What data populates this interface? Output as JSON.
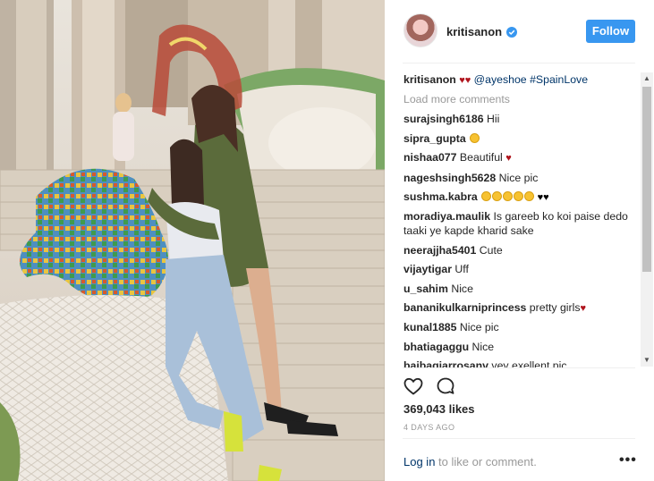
{
  "header": {
    "username": "kritisanon",
    "follow_label": "Follow"
  },
  "caption": {
    "username": "kritisanon",
    "mention": "@ayeshoe",
    "hashtag": "#SpainLove"
  },
  "load_more_label": "Load more comments",
  "comments": [
    {
      "user": "surajsingh6186",
      "text": "Hii"
    },
    {
      "user": "sipra_gupta",
      "text": ""
    },
    {
      "user": "nishaa077",
      "text": "Beautiful"
    },
    {
      "user": "nageshsingh5628",
      "text": "Nice pic"
    },
    {
      "user": "sushma.kabra",
      "text": ""
    },
    {
      "user": "moradiya.maulik",
      "text": "Is gareeb ko koi paise dedo taaki ye kapde kharid sake"
    },
    {
      "user": "neerajjha5401",
      "text": "Cute"
    },
    {
      "user": "vijaytigar",
      "text": "Uff"
    },
    {
      "user": "u_sahim",
      "text": "Nice"
    },
    {
      "user": "bananikulkarniprincess",
      "text": "pretty girls"
    },
    {
      "user": "kunal1885",
      "text": "Nice pic"
    },
    {
      "user": "bhatiagaggu",
      "text": "Nice"
    },
    {
      "user": "baibagiarrosanv",
      "text": "vey exellent pic"
    }
  ],
  "likes": "369,043 likes",
  "time_ago": "4 DAYS AGO",
  "footer": {
    "login_link": "Log in",
    "login_rest": " to like or comment.",
    "more_label": "•••"
  },
  "icons": {
    "verified": "verified-badge-icon",
    "like": "heart-outline-icon",
    "comment": "comment-bubble-icon",
    "more": "more-options-icon"
  },
  "colors": {
    "follow_button": "#3897f0",
    "link": "#003569",
    "muted": "#999999",
    "heart": "#b0141d"
  }
}
